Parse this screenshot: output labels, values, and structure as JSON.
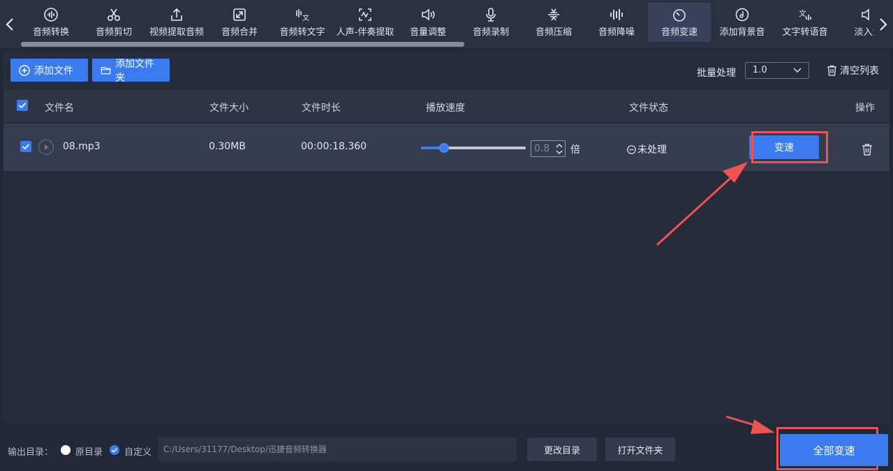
{
  "toolbar": {
    "tools": [
      {
        "label": "音频转换",
        "icon": "audio-convert-icon"
      },
      {
        "label": "音频剪切",
        "icon": "scissors-icon"
      },
      {
        "label": "视频提取音频",
        "icon": "upload-icon"
      },
      {
        "label": "音频合并",
        "icon": "merge-icon"
      },
      {
        "label": "音频转文字",
        "icon": "speech-to-text-icon"
      },
      {
        "label": "人声-伴奏提取",
        "icon": "vocal-extract-icon"
      },
      {
        "label": "音量调整",
        "icon": "volume-icon"
      },
      {
        "label": "音频录制",
        "icon": "microphone-icon"
      },
      {
        "label": "音频压缩",
        "icon": "compress-icon"
      },
      {
        "label": "音频降噪",
        "icon": "denoise-icon"
      },
      {
        "label": "音频变速",
        "icon": "speed-dial-icon"
      },
      {
        "label": "添加背景音",
        "icon": "music-disc-icon"
      },
      {
        "label": "文字转语音",
        "icon": "text-to-speech-icon"
      },
      {
        "label": "淡入淡",
        "icon": "fade-icon"
      }
    ],
    "active_index": 10
  },
  "actions": {
    "add_file": "添加文件",
    "add_folder": "添加文件夹",
    "batch_label": "批量处理",
    "batch_value": "1.0",
    "clear_list": "清空列表"
  },
  "table": {
    "headers": {
      "name": "文件名",
      "size": "文件大小",
      "duration": "文件时长",
      "speed": "播放速度",
      "status": "文件状态",
      "action": "操作"
    },
    "rows": [
      {
        "name": "08.mp3",
        "size": "0.30MB",
        "duration": "00:00:18.360",
        "speed_value": "0.8",
        "slider_fraction": 0.22,
        "unit": "倍",
        "status": "未处理",
        "action_label": "变速"
      }
    ]
  },
  "footer": {
    "output_label": "输出目录：",
    "radio_original": "原目录",
    "radio_custom": "自定义",
    "path": "C:/Users/31177/Desktop/迅捷音频转换器",
    "change_dir": "更改目录",
    "open_folder": "打开文件夹",
    "all_button": "全部变速"
  },
  "colors": {
    "accent": "#3b7bf2",
    "annotation": "#f0524f"
  }
}
